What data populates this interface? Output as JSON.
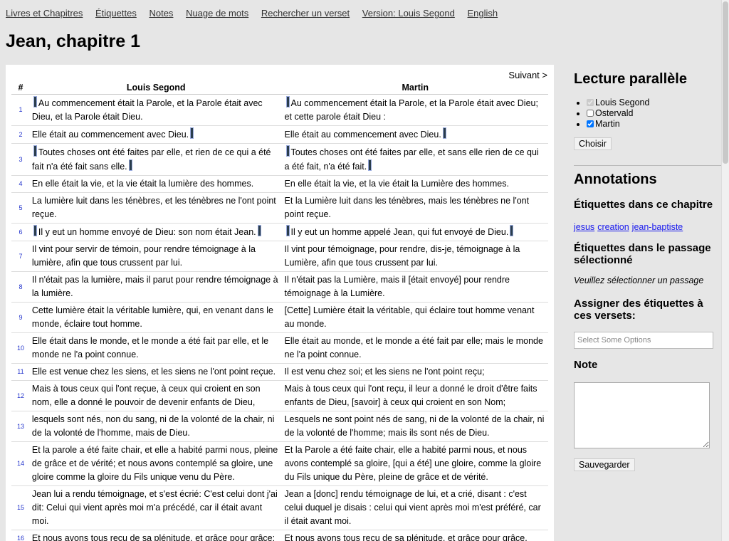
{
  "nav": {
    "items": [
      "Livres et Chapitres",
      "Étiquettes",
      "Notes",
      "Nuage de mots",
      "Rechercher un verset",
      "Version: Louis Segond",
      "English"
    ]
  },
  "page_title": "Jean, chapitre 1",
  "main": {
    "next_label": "Suivant >",
    "col_num": "#",
    "col_a": "Louis Segond",
    "col_b": "Martin",
    "verses": [
      {
        "n": "1",
        "a": "Au commencement était la Parole, et la Parole était avec Dieu, et la Parole était Dieu.",
        "b": "Au commencement était la Parole, et la Parole était avec Dieu; et cette parole était Dieu :",
        "ma": [
          true,
          false
        ],
        "mb": [
          true,
          false
        ]
      },
      {
        "n": "2",
        "a": "Elle était au commencement avec Dieu.",
        "b": "Elle était au commencement avec Dieu.",
        "ma": [
          false,
          true
        ],
        "mb": [
          false,
          true
        ]
      },
      {
        "n": "3",
        "a": "Toutes choses ont été faites par elle, et rien de ce qui a été fait n'a été fait sans elle.",
        "b": "Toutes choses ont été faites par elle, et sans elle rien de ce qui a été fait, n'a été fait.",
        "ma": [
          true,
          true
        ],
        "mb": [
          true,
          true
        ]
      },
      {
        "n": "4",
        "a": "En elle était la vie, et la vie était la lumière des hommes.",
        "b": "En elle était la vie, et la vie était la Lumière des hommes.",
        "ma": [
          false,
          false
        ],
        "mb": [
          false,
          false
        ]
      },
      {
        "n": "5",
        "a": "La lumière luit dans les ténèbres, et les ténèbres ne l'ont point reçue.",
        "b": "Et la Lumière luit dans les ténèbres, mais les ténèbres ne l'ont point reçue.",
        "ma": [
          false,
          false
        ],
        "mb": [
          false,
          false
        ]
      },
      {
        "n": "6",
        "a": "Il y eut un homme envoyé de Dieu: son nom était Jean.",
        "b": "Il y eut un homme appelé Jean, qui fut envoyé de Dieu.",
        "ma": [
          true,
          true
        ],
        "mb": [
          true,
          true
        ]
      },
      {
        "n": "7",
        "a": "Il vint pour servir de témoin, pour rendre témoignage à la lumière, afin que tous crussent par lui.",
        "b": "Il vint pour témoignage, pour rendre, dis-je, témoignage à la Lumière, afin que tous crussent par lui.",
        "ma": [
          false,
          false
        ],
        "mb": [
          false,
          false
        ]
      },
      {
        "n": "8",
        "a": "Il n'était pas la lumière, mais il parut pour rendre témoignage à la lumière.",
        "b": "Il n'était pas la Lumière, mais il [était envoyé] pour rendre témoignage à la Lumière.",
        "ma": [
          false,
          false
        ],
        "mb": [
          false,
          false
        ]
      },
      {
        "n": "9",
        "a": "Cette lumière était la véritable lumière, qui, en venant dans le monde, éclaire tout homme.",
        "b": "[Cette] Lumière était la véritable, qui éclaire tout homme venant au monde.",
        "ma": [
          false,
          false
        ],
        "mb": [
          false,
          false
        ]
      },
      {
        "n": "10",
        "a": "Elle était dans le monde, et le monde a été fait par elle, et le monde ne l'a point connue.",
        "b": "Elle était au monde, et le monde a été fait par elle; mais le monde ne l'a point connue.",
        "ma": [
          false,
          false
        ],
        "mb": [
          false,
          false
        ]
      },
      {
        "n": "11",
        "a": "Elle est venue chez les siens, et les siens ne l'ont point reçue.",
        "b": "Il est venu chez soi; et les siens ne l'ont point reçu;",
        "ma": [
          false,
          false
        ],
        "mb": [
          false,
          false
        ]
      },
      {
        "n": "12",
        "a": "Mais à tous ceux qui l'ont reçue, à ceux qui croient en son nom, elle a donné le pouvoir de devenir enfants de Dieu,",
        "b": "Mais à tous ceux qui l'ont reçu, il leur a donné le droit d'être faits enfants de Dieu, [savoir] à ceux qui croient en son Nom;",
        "ma": [
          false,
          false
        ],
        "mb": [
          false,
          false
        ]
      },
      {
        "n": "13",
        "a": "lesquels sont nés, non du sang, ni de la volonté de la chair, ni de la volonté de l'homme, mais de Dieu.",
        "b": "Lesquels ne sont point nés de sang, ni de la volonté de la chair, ni de la volonté de l'homme; mais ils sont nés de Dieu.",
        "ma": [
          false,
          false
        ],
        "mb": [
          false,
          false
        ]
      },
      {
        "n": "14",
        "a": "Et la parole a été faite chair, et elle a habité parmi nous, pleine de grâce et de vérité; et nous avons contemplé sa gloire, une gloire comme la gloire du Fils unique venu du Père.",
        "b": "Et la Parole a été faite chair, elle a habité parmi nous, et nous avons contemplé sa gloire, [qui a été] une gloire, comme la gloire du Fils unique du Père, pleine de grâce et de vérité.",
        "ma": [
          false,
          false
        ],
        "mb": [
          false,
          false
        ]
      },
      {
        "n": "15",
        "a": "Jean lui a rendu témoignage, et s'est écrié: C'est celui dont j'ai dit: Celui qui vient après moi m'a précédé, car il était avant moi.",
        "b": "Jean a [donc] rendu témoignage de lui, et a crié, disant : c'est celui duquel je disais : celui qui vient après moi m'est préféré, car il était avant moi.",
        "ma": [
          false,
          false
        ],
        "mb": [
          false,
          false
        ]
      },
      {
        "n": "16",
        "a": "Et nous avons tous reçu de sa plénitude, et grâce pour grâce;",
        "b": "Et nous avons tous reçu de sa plénitude, et grâce pour grâce.",
        "ma": [
          false,
          false
        ],
        "mb": [
          false,
          false
        ]
      }
    ]
  },
  "sidebar": {
    "parallel_title": "Lecture parallèle",
    "versions": [
      {
        "label": "Louis Segond",
        "checked": true,
        "disabled": true
      },
      {
        "label": "Ostervald",
        "checked": false,
        "disabled": false
      },
      {
        "label": "Martin",
        "checked": true,
        "disabled": false
      }
    ],
    "choose_label": "Choisir",
    "annotations_title": "Annotations",
    "tags_chapter_title": "Étiquettes dans ce chapitre",
    "tags": [
      "jesus",
      "creation",
      "jean-baptiste"
    ],
    "tags_passage_title": "Étiquettes dans le passage sélectionné",
    "passage_hint": "Veuillez sélectionner un passage",
    "assign_title": "Assigner des étiquettes à ces versets:",
    "select_placeholder": "Select Some Options",
    "note_title": "Note",
    "save_label": "Sauvegarder"
  },
  "colors": {
    "background": "#e6e6e6",
    "link": "#1a1aee",
    "verse_number": "#2233cc",
    "marker": "#2a3d4c"
  }
}
